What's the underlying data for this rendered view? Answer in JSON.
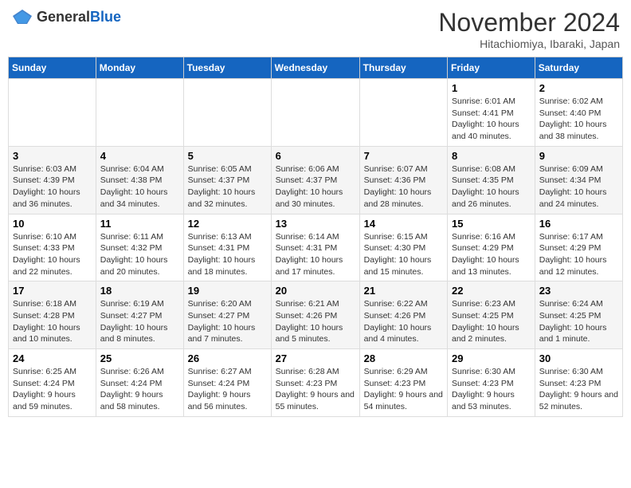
{
  "header": {
    "logo_general": "General",
    "logo_blue": "Blue",
    "title": "November 2024",
    "location": "Hitachiomiya, Ibaraki, Japan"
  },
  "days_of_week": [
    "Sunday",
    "Monday",
    "Tuesday",
    "Wednesday",
    "Thursday",
    "Friday",
    "Saturday"
  ],
  "weeks": [
    [
      {
        "day": "",
        "info": ""
      },
      {
        "day": "",
        "info": ""
      },
      {
        "day": "",
        "info": ""
      },
      {
        "day": "",
        "info": ""
      },
      {
        "day": "",
        "info": ""
      },
      {
        "day": "1",
        "info": "Sunrise: 6:01 AM\nSunset: 4:41 PM\nDaylight: 10 hours and 40 minutes."
      },
      {
        "day": "2",
        "info": "Sunrise: 6:02 AM\nSunset: 4:40 PM\nDaylight: 10 hours and 38 minutes."
      }
    ],
    [
      {
        "day": "3",
        "info": "Sunrise: 6:03 AM\nSunset: 4:39 PM\nDaylight: 10 hours and 36 minutes."
      },
      {
        "day": "4",
        "info": "Sunrise: 6:04 AM\nSunset: 4:38 PM\nDaylight: 10 hours and 34 minutes."
      },
      {
        "day": "5",
        "info": "Sunrise: 6:05 AM\nSunset: 4:37 PM\nDaylight: 10 hours and 32 minutes."
      },
      {
        "day": "6",
        "info": "Sunrise: 6:06 AM\nSunset: 4:37 PM\nDaylight: 10 hours and 30 minutes."
      },
      {
        "day": "7",
        "info": "Sunrise: 6:07 AM\nSunset: 4:36 PM\nDaylight: 10 hours and 28 minutes."
      },
      {
        "day": "8",
        "info": "Sunrise: 6:08 AM\nSunset: 4:35 PM\nDaylight: 10 hours and 26 minutes."
      },
      {
        "day": "9",
        "info": "Sunrise: 6:09 AM\nSunset: 4:34 PM\nDaylight: 10 hours and 24 minutes."
      }
    ],
    [
      {
        "day": "10",
        "info": "Sunrise: 6:10 AM\nSunset: 4:33 PM\nDaylight: 10 hours and 22 minutes."
      },
      {
        "day": "11",
        "info": "Sunrise: 6:11 AM\nSunset: 4:32 PM\nDaylight: 10 hours and 20 minutes."
      },
      {
        "day": "12",
        "info": "Sunrise: 6:13 AM\nSunset: 4:31 PM\nDaylight: 10 hours and 18 minutes."
      },
      {
        "day": "13",
        "info": "Sunrise: 6:14 AM\nSunset: 4:31 PM\nDaylight: 10 hours and 17 minutes."
      },
      {
        "day": "14",
        "info": "Sunrise: 6:15 AM\nSunset: 4:30 PM\nDaylight: 10 hours and 15 minutes."
      },
      {
        "day": "15",
        "info": "Sunrise: 6:16 AM\nSunset: 4:29 PM\nDaylight: 10 hours and 13 minutes."
      },
      {
        "day": "16",
        "info": "Sunrise: 6:17 AM\nSunset: 4:29 PM\nDaylight: 10 hours and 12 minutes."
      }
    ],
    [
      {
        "day": "17",
        "info": "Sunrise: 6:18 AM\nSunset: 4:28 PM\nDaylight: 10 hours and 10 minutes."
      },
      {
        "day": "18",
        "info": "Sunrise: 6:19 AM\nSunset: 4:27 PM\nDaylight: 10 hours and 8 minutes."
      },
      {
        "day": "19",
        "info": "Sunrise: 6:20 AM\nSunset: 4:27 PM\nDaylight: 10 hours and 7 minutes."
      },
      {
        "day": "20",
        "info": "Sunrise: 6:21 AM\nSunset: 4:26 PM\nDaylight: 10 hours and 5 minutes."
      },
      {
        "day": "21",
        "info": "Sunrise: 6:22 AM\nSunset: 4:26 PM\nDaylight: 10 hours and 4 minutes."
      },
      {
        "day": "22",
        "info": "Sunrise: 6:23 AM\nSunset: 4:25 PM\nDaylight: 10 hours and 2 minutes."
      },
      {
        "day": "23",
        "info": "Sunrise: 6:24 AM\nSunset: 4:25 PM\nDaylight: 10 hours and 1 minute."
      }
    ],
    [
      {
        "day": "24",
        "info": "Sunrise: 6:25 AM\nSunset: 4:24 PM\nDaylight: 9 hours and 59 minutes."
      },
      {
        "day": "25",
        "info": "Sunrise: 6:26 AM\nSunset: 4:24 PM\nDaylight: 9 hours and 58 minutes."
      },
      {
        "day": "26",
        "info": "Sunrise: 6:27 AM\nSunset: 4:24 PM\nDaylight: 9 hours and 56 minutes."
      },
      {
        "day": "27",
        "info": "Sunrise: 6:28 AM\nSunset: 4:23 PM\nDaylight: 9 hours and 55 minutes."
      },
      {
        "day": "28",
        "info": "Sunrise: 6:29 AM\nSunset: 4:23 PM\nDaylight: 9 hours and 54 minutes."
      },
      {
        "day": "29",
        "info": "Sunrise: 6:30 AM\nSunset: 4:23 PM\nDaylight: 9 hours and 53 minutes."
      },
      {
        "day": "30",
        "info": "Sunrise: 6:30 AM\nSunset: 4:23 PM\nDaylight: 9 hours and 52 minutes."
      }
    ]
  ]
}
